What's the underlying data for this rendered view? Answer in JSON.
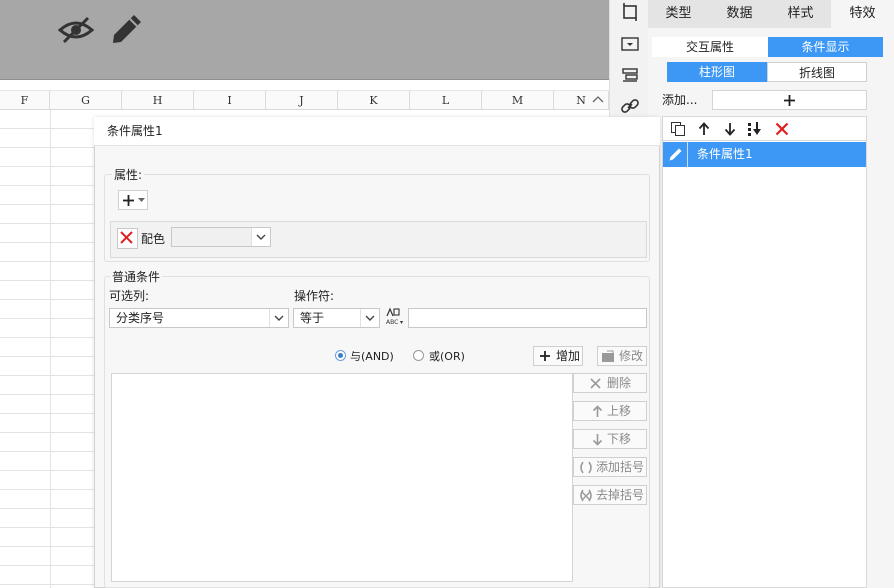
{
  "spreadsheet": {
    "columns": [
      "F",
      "G",
      "H",
      "I",
      "J",
      "K",
      "L",
      "M",
      "N"
    ]
  },
  "right_panel": {
    "main_tabs": [
      "类型",
      "数据",
      "样式",
      "特效"
    ],
    "sub_tabs": [
      "交互属性",
      "条件显示"
    ],
    "chart_tabs": [
      "柱形图",
      "折线图"
    ],
    "add_label": "添加...",
    "list_item": "条件属性1"
  },
  "dialog": {
    "title": "条件属性1",
    "property_section": "属性:",
    "color_label": "配色",
    "normal_condition": "普通条件",
    "optional_column_label": "可选列:",
    "optional_column_value": "分类序号",
    "operator_label": "操作符:",
    "operator_value": "等于",
    "value_input": "",
    "radio_and": "与(AND)",
    "radio_or": "或(OR)",
    "add_button": "增加",
    "modify_button": "修改",
    "delete_button": "删除",
    "move_up_button": "上移",
    "move_down_button": "下移",
    "add_bracket_button": "添加括号",
    "remove_bracket_button": "去掉括号"
  }
}
